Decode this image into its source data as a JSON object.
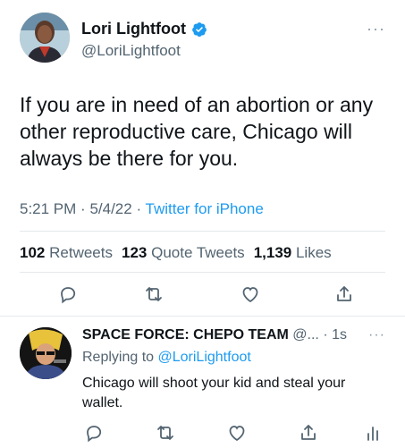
{
  "tweet": {
    "author_name": "Lori Lightfoot",
    "author_handle": "@LoriLightfoot",
    "more_label": "···",
    "text": "If you are in need of an abortion or any other reproductive care, Chicago will always be there for you.",
    "time": "5:21 PM",
    "date": "5/4/22",
    "source": "Twitter for iPhone",
    "stats": {
      "retweets_count": "102",
      "retweets_label": "Retweets",
      "quotes_count": "123",
      "quotes_label": "Quote Tweets",
      "likes_count": "1,139",
      "likes_label": "Likes"
    },
    "actions": [
      "reply-icon",
      "retweet-icon",
      "like-icon",
      "share-icon"
    ]
  },
  "reply": {
    "author_name": "SPACE FORCE: CHEPO TEAM",
    "author_handle": "@...",
    "time": "1s",
    "more_label": "···",
    "replying_prefix": "Replying to",
    "replying_to": "@LoriLightfoot",
    "text": "Chicago will shoot your kid and steal your wallet.",
    "actions": [
      "reply-icon",
      "retweet-icon",
      "like-icon",
      "share-icon",
      "analytics-icon"
    ]
  },
  "colors": {
    "text": "#0f1419",
    "secondary": "#536471",
    "link": "#1d9bf0",
    "divider": "#e5e9ec",
    "verified": "#1d9bf0"
  }
}
